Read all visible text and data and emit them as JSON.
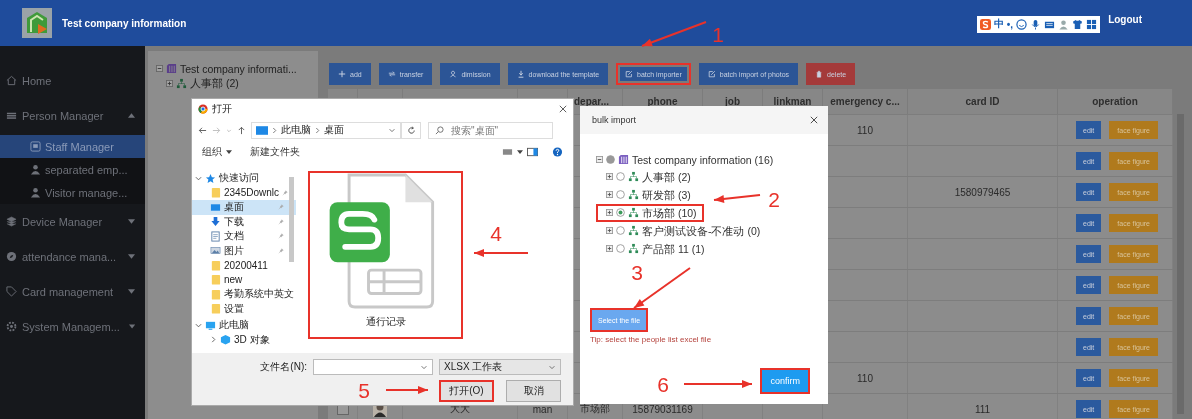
{
  "header": {
    "title": "Test company information",
    "ime": {
      "mode": "中",
      "punctuation": "•,"
    },
    "logout": "Logout"
  },
  "sidebar": {
    "items": [
      {
        "label": "Home",
        "kind": "home"
      },
      {
        "label": "Person Manager",
        "kind": "people",
        "expanded": true,
        "children": [
          {
            "label": "Staff Manager",
            "kind": "staff",
            "selected": true
          },
          {
            "label": "separated emp...",
            "kind": "person",
            "selected": false
          },
          {
            "label": "Visitor manage...",
            "kind": "person",
            "selected": false
          }
        ]
      },
      {
        "label": "Device Manager",
        "kind": "device",
        "expanded": false
      },
      {
        "label": "attendance mana...",
        "kind": "attendance",
        "expanded": false
      },
      {
        "label": "Card management",
        "kind": "card",
        "expanded": false
      },
      {
        "label": "System Managem...",
        "kind": "system",
        "expanded": false
      }
    ]
  },
  "tree": {
    "label": "Test company informati...",
    "expanded": true,
    "children": [
      {
        "label": "人事部 (2)",
        "expanded": false
      }
    ]
  },
  "toolbar": [
    {
      "label": "add",
      "kind": "add",
      "highlighted": false
    },
    {
      "label": "transfer",
      "kind": "transfer",
      "highlighted": false
    },
    {
      "label": "dimission",
      "kind": "dimission",
      "highlighted": false
    },
    {
      "label": "download the template",
      "kind": "download",
      "highlighted": false
    },
    {
      "label": "batch importer",
      "kind": "import",
      "highlighted": true
    },
    {
      "label": "batch import of photos",
      "kind": "import",
      "highlighted": false
    },
    {
      "label": "delete",
      "kind": "delete",
      "highlighted": false
    }
  ],
  "table": {
    "columns": [
      "depar...",
      "phone",
      "job",
      "linkman",
      "emergency c...",
      "card ID",
      "operation"
    ],
    "rows": [
      {
        "emergency_contact": "110",
        "actions": [
          "edit",
          "face figure"
        ]
      },
      {
        "actions": [
          "edit",
          "face figure"
        ]
      },
      {
        "card_id": "1580979465",
        "actions": [
          "edit",
          "face figure"
        ]
      },
      {
        "actions": [
          "edit",
          "face figure"
        ]
      },
      {
        "actions": [
          "edit",
          "face figure"
        ]
      },
      {
        "actions": [
          "edit",
          "face figure"
        ]
      },
      {
        "actions": [
          "edit",
          "face figure"
        ]
      },
      {
        "actions": [
          "edit",
          "face figure"
        ]
      },
      {
        "emergency_contact": "110",
        "actions": [
          "edit",
          "face figure"
        ]
      },
      {
        "checked": false,
        "photo": true,
        "name": "大大",
        "gender": "man",
        "department": "市场部",
        "phone": "15879031169",
        "card_id": "111",
        "actions": [
          "edit",
          "face figure"
        ]
      }
    ]
  },
  "file_dialog": {
    "title": "打开",
    "path": [
      "此电脑",
      "桌面"
    ],
    "search": {
      "placeholder": "搜索\"桌面\""
    },
    "organize": "组织",
    "new_folder": "新建文件夹",
    "nav": [
      {
        "label": "快速访问",
        "kind": "star",
        "expanded": true,
        "children": [
          {
            "label": "2345Downlc",
            "kind": "folder",
            "pinned": true,
            "selected": false
          },
          {
            "label": "桌面",
            "kind": "desktop",
            "pinned": true,
            "selected": true
          },
          {
            "label": "下载",
            "kind": "download",
            "pinned": true,
            "selected": false
          },
          {
            "label": "文档",
            "kind": "document",
            "pinned": true,
            "selected": false
          },
          {
            "label": "图片",
            "kind": "picture",
            "pinned": true,
            "selected": false
          },
          {
            "label": "20200411",
            "kind": "folder",
            "pinned": false,
            "selected": false
          },
          {
            "label": "new",
            "kind": "folder",
            "pinned": false,
            "selected": false
          },
          {
            "label": "考勤系统中英文",
            "kind": "folder",
            "pinned": false,
            "selected": false
          },
          {
            "label": "设置",
            "kind": "folder",
            "pinned": false,
            "selected": false
          }
        ]
      },
      {
        "label": "此电脑",
        "kind": "pc",
        "expanded": true,
        "children": [
          {
            "label": "3D 对象",
            "kind": "cube",
            "pinned": false,
            "selected": false
          }
        ]
      }
    ],
    "files": [
      {
        "name": "通行记录",
        "kind": "spreadsheet",
        "highlighted": true
      }
    ],
    "filename_label": "文件名(N):",
    "file_type": "XLSX 工作表",
    "buttons": [
      {
        "label": "打开(O)",
        "kind": "primary",
        "highlighted": true
      },
      {
        "label": "取消",
        "kind": "normal",
        "highlighted": false
      }
    ]
  },
  "bulk_import": {
    "title": "bulk import",
    "tree": {
      "label": "Test company information (16)",
      "expanded": true,
      "disabled": true,
      "children": [
        {
          "label": "人事部 (2)",
          "selected": false,
          "highlighted": false
        },
        {
          "label": "研发部 (3)",
          "selected": false,
          "highlighted": false
        },
        {
          "label": "市场部 (10)",
          "selected": true,
          "highlighted": true
        },
        {
          "label": "客户测试设备-不准动 (0)",
          "selected": false,
          "highlighted": false
        },
        {
          "label": "产品部 11 (1)",
          "selected": false,
          "highlighted": false
        }
      ]
    },
    "select_button": {
      "label": "Select the file",
      "highlighted": true
    },
    "tip": "Tip: select the people list excel file",
    "confirm": {
      "label": "confirm",
      "highlighted": true
    }
  },
  "annotations": [
    {
      "label": "1"
    },
    {
      "label": "2"
    },
    {
      "label": "3"
    },
    {
      "label": "4"
    },
    {
      "label": "5"
    },
    {
      "label": "6"
    }
  ]
}
